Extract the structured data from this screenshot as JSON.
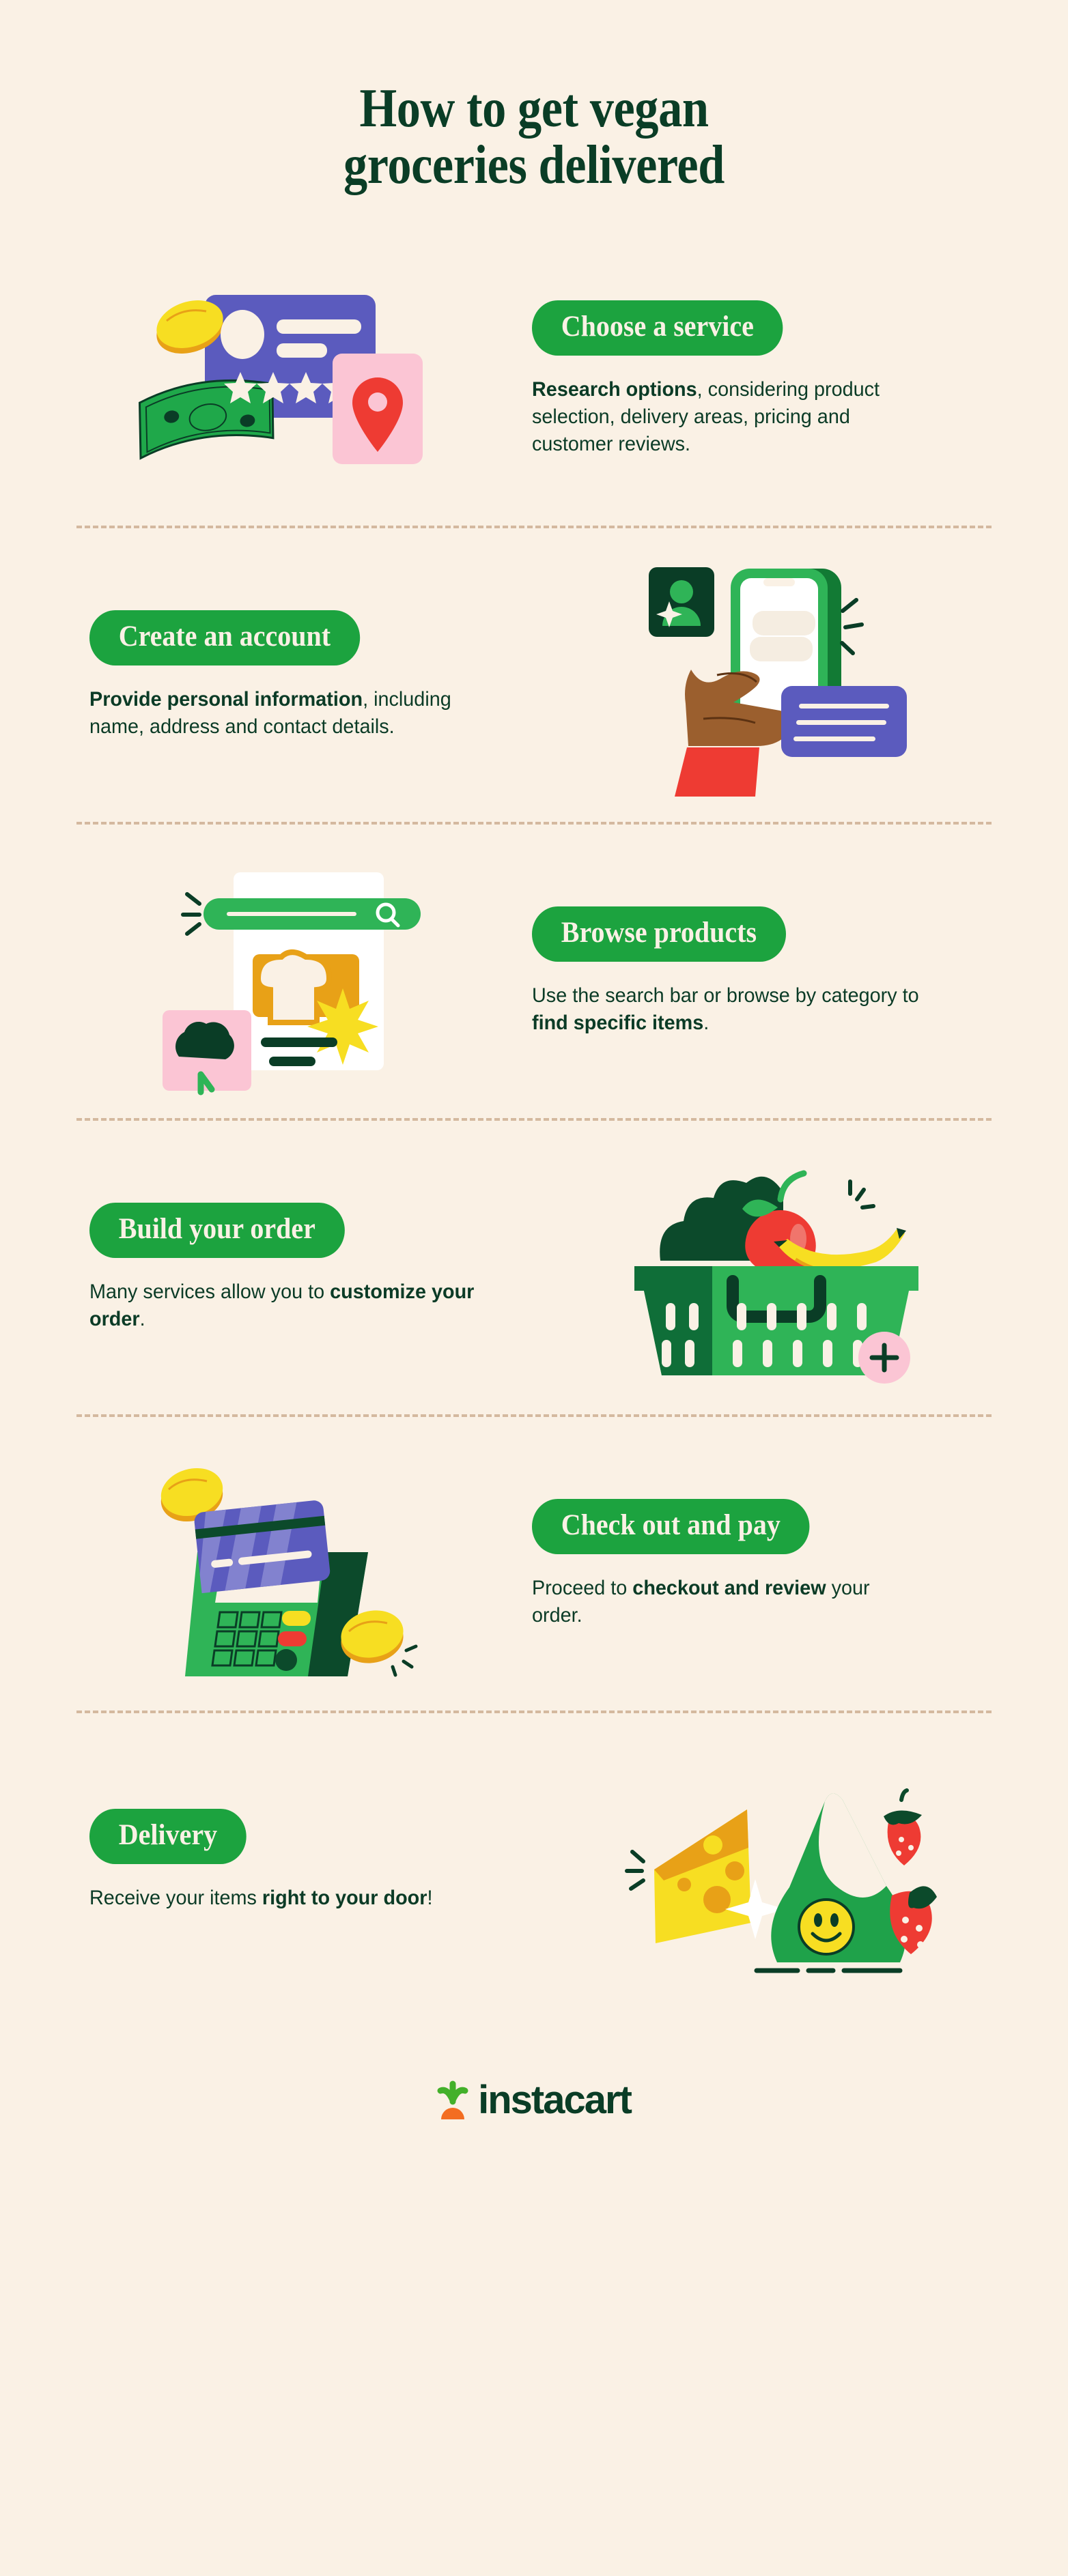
{
  "theme": {
    "background": "#FAF1E5",
    "pill_green": "#1CA33F",
    "dark_green": "#0A3D26",
    "text_green": "#0B3B26",
    "divider": "#D4B99F",
    "cream": "#FAF1E5",
    "purple": "#5B5BBE",
    "pink": "#FBC5D4",
    "red": "#EE3B33",
    "yellow": "#F7DE22",
    "orange": "#E8A117",
    "brand_orange": "#F36D21",
    "brand_green": "#43B02A",
    "skin": "#9B5F2E",
    "money_green": "#1FA84A"
  },
  "header": {
    "title_line1": "How to get vegan",
    "title_line2": "groceries delivered"
  },
  "steps": [
    {
      "id": "choose-a-service",
      "pill_label": "Choose a service",
      "body_bold": "Research options",
      "body_rest": ", considering product selection, delivery areas, pricing and customer reviews.",
      "layout": "text-right",
      "art": "review-card-illustration"
    },
    {
      "id": "create-an-account",
      "pill_label": "Create an account",
      "body_bold": "Provide personal information",
      "body_rest": ", including name, address and contact details.",
      "layout": "text-left",
      "art": "phone-in-hand-illustration"
    },
    {
      "id": "browse-products",
      "pill_label": "Browse products",
      "body_pre": "Use the search bar or browse by category to ",
      "body_bold": "find specific items",
      "body_rest": ".",
      "layout": "text-right",
      "art": "search-products-illustration"
    },
    {
      "id": "build-your-order",
      "pill_label": "Build your order",
      "body_pre": "Many services allow you to ",
      "body_bold": "customize your order",
      "body_rest": ".",
      "layout": "text-left",
      "art": "grocery-basket-illustration"
    },
    {
      "id": "check-out-and-pay",
      "pill_label": "Check out and pay",
      "body_pre": "Proceed to ",
      "body_bold": "checkout and review",
      "body_rest": " your order.",
      "layout": "text-right",
      "art": "card-terminal-illustration"
    },
    {
      "id": "delivery",
      "pill_label": "Delivery",
      "body_pre": "Receive your items ",
      "body_bold": "right to your door",
      "body_rest": "!",
      "layout": "text-left",
      "art": "grocery-bag-illustration"
    }
  ],
  "footer": {
    "logo_word": "instacart",
    "logo_mark": "carrot-icon"
  },
  "illustration_elements": {
    "review_card": {
      "stars": 4,
      "avatar": "avatar-circle",
      "coin": "coin-icon",
      "banknote": "banknote-icon",
      "map_pin": "location-pin-icon"
    },
    "phone": {
      "badge": "profile-badge-icon",
      "sparkle": "sparkle-icon",
      "form_card": "form-card-icon"
    },
    "search": {
      "search_bar": "search-bar",
      "search_icon": "magnifier-icon",
      "bread": "bread-icon",
      "broccoli": "broccoli-icon",
      "star": "star-burst-icon"
    },
    "basket": {
      "apple": "apple-icon",
      "banana": "banana-icon",
      "greens": "leafy-greens-icon",
      "plus": "plus-circle-icon"
    },
    "terminal": {
      "card": "credit-card-icon",
      "coins": "coin-icon",
      "keypad": "keypad-icon"
    },
    "bag": {
      "cheese": "cheese-icon",
      "strawberries": "strawberry-icon",
      "smiley": "smiley-icon",
      "sparkle": "sparkle-icon"
    }
  }
}
